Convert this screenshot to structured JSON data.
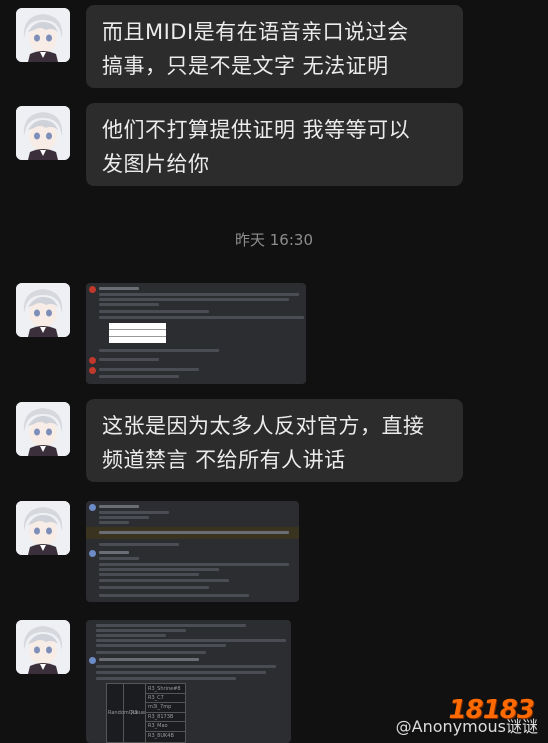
{
  "messages": [
    {
      "type": "text",
      "text": "而且MIDI是有在语音亲口说过会\n搞事，只是不是文字 无法证明"
    },
    {
      "type": "text",
      "text": "他们不打算提供证明 我等等可以\n发图片给你"
    },
    {
      "type": "timestamp",
      "text": "昨天 16:30"
    },
    {
      "type": "image",
      "desc": "screenshot-1"
    },
    {
      "type": "text",
      "text": "这张是因为太多人反对官方，直接\n频道禁言 不给所有人讲话"
    },
    {
      "type": "image",
      "desc": "screenshot-2"
    },
    {
      "type": "image",
      "desc": "screenshot-3"
    }
  ],
  "table3": {
    "left_label": "RandomQueue",
    "mid_label": "R3",
    "rows": [
      "R3_Shrine#8",
      "R3_C7",
      "m3I_7mp",
      "R3_8173B",
      "R3_Mao",
      "R3_8UK4B"
    ]
  },
  "watermark": {
    "logo": "18183",
    "text": "@Anonymous谜谜"
  },
  "colors": {
    "background": "#111111",
    "bubble": "#2c2c2c",
    "timestamp": "#8d8d8d",
    "discord_bg": "#2b2d31"
  }
}
